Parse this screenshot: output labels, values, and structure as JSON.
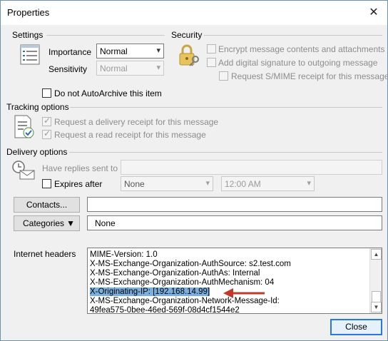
{
  "window": {
    "title": "Properties",
    "close_glyph": "✕"
  },
  "settings": {
    "title": "Settings",
    "importance_label": "Importance",
    "importance_value": "Normal",
    "sensitivity_label": "Sensitivity",
    "sensitivity_value": "Normal",
    "autoarchive_label": "Do not AutoArchive this item",
    "autoarchive_checked": false
  },
  "security": {
    "title": "Security",
    "encrypt_label": "Encrypt message contents and attachments",
    "signature_label": "Add digital signature to outgoing message",
    "smime_label": "Request S/MIME receipt for this message"
  },
  "tracking": {
    "title": "Tracking options",
    "delivery_label": "Request a delivery receipt for this message",
    "read_label": "Request a read receipt for this message",
    "delivery_checked": true,
    "read_checked": true
  },
  "delivery": {
    "title": "Delivery options",
    "replies_label": "Have replies sent to",
    "replies_value": "",
    "expires_label": "Expires after",
    "expires_date": "None",
    "expires_time": "12:00 AM"
  },
  "contacts": {
    "button_label": "Contacts...",
    "value": ""
  },
  "categories": {
    "button_label": "Categories",
    "value": "None"
  },
  "internet_headers": {
    "label": "Internet headers",
    "lines": [
      "MIME-Version: 1.0",
      "X-MS-Exchange-Organization-AuthSource: s2.test.com",
      "X-MS-Exchange-Organization-AuthAs: Internal",
      "X-MS-Exchange-Organization-AuthMechanism: 04",
      "X-Originating-IP: [192.168.14.99]",
      "X-MS-Exchange-Organization-Network-Message-Id:",
      "49fea575-0bee-46ed-569f-08d4cf1544e2"
    ],
    "selected_line": "X-Originating-IP: [192.168.14.99]"
  },
  "footer": {
    "close_label": "Close"
  },
  "colors": {
    "annotation_arrow": "#c0392b",
    "selection": "#7ab0e0",
    "focus_border": "#2b79d7"
  },
  "icons": [
    "settings-list-icon",
    "lock-key-icon",
    "tracking-receipt-icon",
    "delivery-clock-icon",
    "dropdown-arrow-icon",
    "close-icon",
    "annotation-arrow"
  ]
}
